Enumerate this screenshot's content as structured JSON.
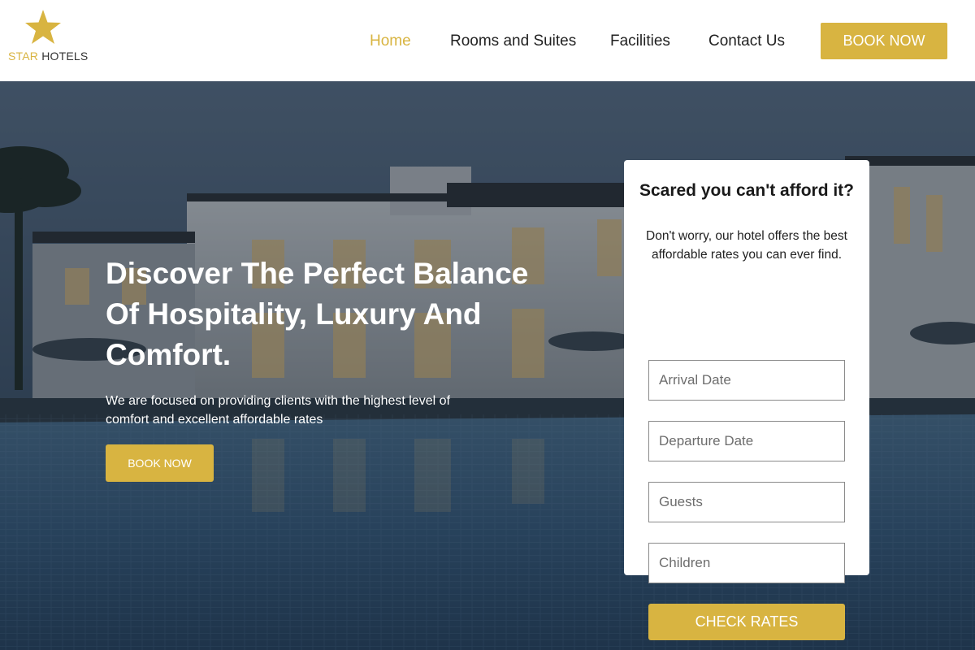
{
  "brand": {
    "logo_icon": "star-icon",
    "name_part1": "STAR",
    "name_part2": "HOTELS",
    "accent_color": "#d8b441"
  },
  "nav": {
    "items": [
      {
        "label": "Home",
        "active": true
      },
      {
        "label": "Rooms and Suites",
        "active": false
      },
      {
        "label": "Facilities",
        "active": false
      },
      {
        "label": "Contact Us",
        "active": false
      }
    ],
    "cta_label": "BOOK NOW"
  },
  "hero": {
    "title": "Discover The Perfect Balance Of Hospitality, Luxury And Comfort.",
    "subtitle": "We are focused on providing clients with the highest level of comfort and excellent affordable rates",
    "cta_label": "BOOK NOW"
  },
  "rates_card": {
    "title": "Scared you can't afford it?",
    "text": "Don't worry, our hotel offers the best affordable rates you can ever find.",
    "fields": {
      "arrival": {
        "placeholder": "Arrival Date",
        "value": ""
      },
      "departure": {
        "placeholder": "Departure Date",
        "value": ""
      },
      "guests": {
        "placeholder": "Guests",
        "value": ""
      },
      "children": {
        "placeholder": "Children",
        "value": ""
      }
    },
    "submit_label": "CHECK RATES"
  }
}
